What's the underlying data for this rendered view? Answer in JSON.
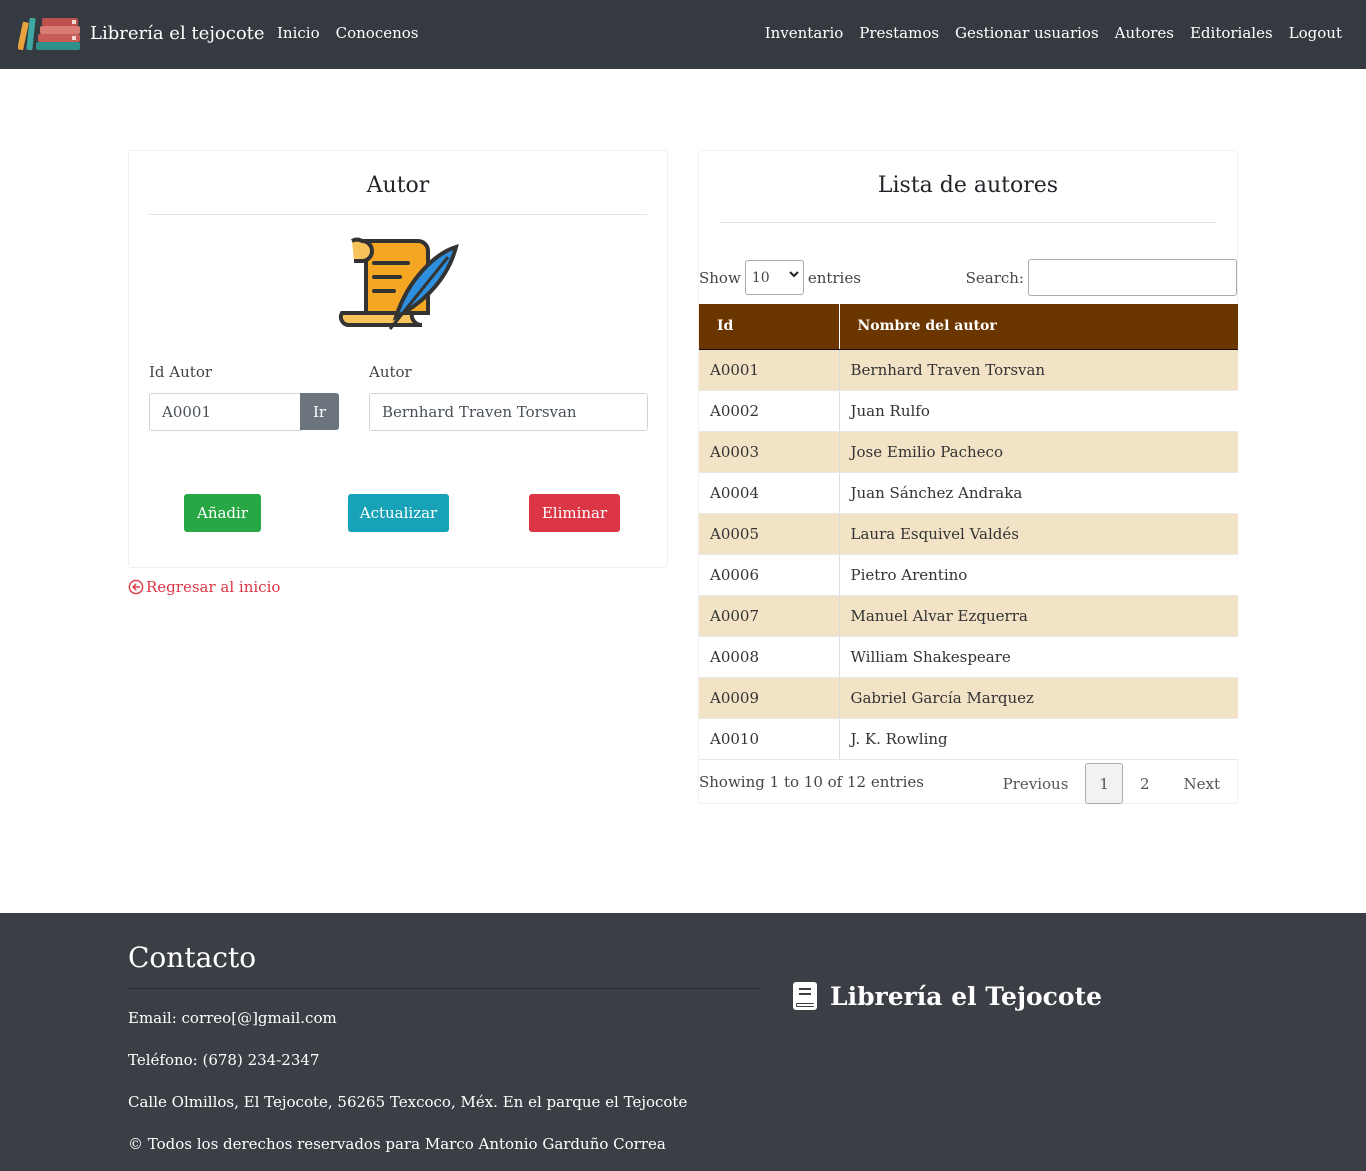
{
  "navbar": {
    "brand": "Librería el tejocote",
    "left_links": [
      "Inicio",
      "Conocenos"
    ],
    "right_links": [
      "Inventario",
      "Prestamos",
      "Gestionar usuarios",
      "Autores",
      "Editoriales",
      "Logout"
    ]
  },
  "form": {
    "title": "Autor",
    "id_label": "Id Autor",
    "id_value": "A0001",
    "go_button": "Ir",
    "autor_label": "Autor",
    "autor_value": "Bernhard Traven Torsvan",
    "add_button": "Añadir",
    "update_button": "Actualizar",
    "delete_button": "Eliminar",
    "back_link": "Regresar al inicio"
  },
  "list": {
    "title": "Lista de autores",
    "show_label": "Show",
    "entries_value": "10",
    "entries_label": "entries",
    "search_label": "Search:",
    "columns": [
      "Id",
      "Nombre del autor"
    ],
    "rows": [
      [
        "A0001",
        "Bernhard Traven Torsvan"
      ],
      [
        "A0002",
        "Juan Rulfo"
      ],
      [
        "A0003",
        "Jose Emilio Pacheco"
      ],
      [
        "A0004",
        "Juan Sánchez Andraka"
      ],
      [
        "A0005",
        "Laura Esquivel Valdés"
      ],
      [
        "A0006",
        "Pietro Arentino"
      ],
      [
        "A0007",
        "Manuel Alvar Ezquerra"
      ],
      [
        "A0008",
        "William Shakespeare"
      ],
      [
        "A0009",
        "Gabriel García Marquez"
      ],
      [
        "A0010",
        "J. K. Rowling"
      ]
    ],
    "info": "Showing 1 to 10 of 12 entries",
    "pager": {
      "previous": "Previous",
      "pages": [
        "1",
        "2"
      ],
      "next": "Next"
    }
  },
  "footer": {
    "title": "Contacto",
    "email": "Email: correo[@]gmail.com",
    "phone": "Teléfono: (678) 234-2347",
    "address": "Calle Olmillos, El Tejocote, 56265 Texcoco, Méx. En el parque el Tejocote",
    "copyright": "© Todos los derechos reservados para Marco Antonio Garduño Correa",
    "brand": "Librería el Tejocote"
  },
  "colors": {
    "navbar": "#343a40",
    "table_header": "#6b3500",
    "row_odd": "#f2e3c6",
    "add": "#28a745",
    "update": "#17a2b8",
    "delete": "#dc3545",
    "footer": "#3b3e44"
  },
  "icons": [
    "books-logo-icon",
    "scroll-quill-icon",
    "arrow-circle-left-icon",
    "select-chevron-icon",
    "book-icon"
  ]
}
